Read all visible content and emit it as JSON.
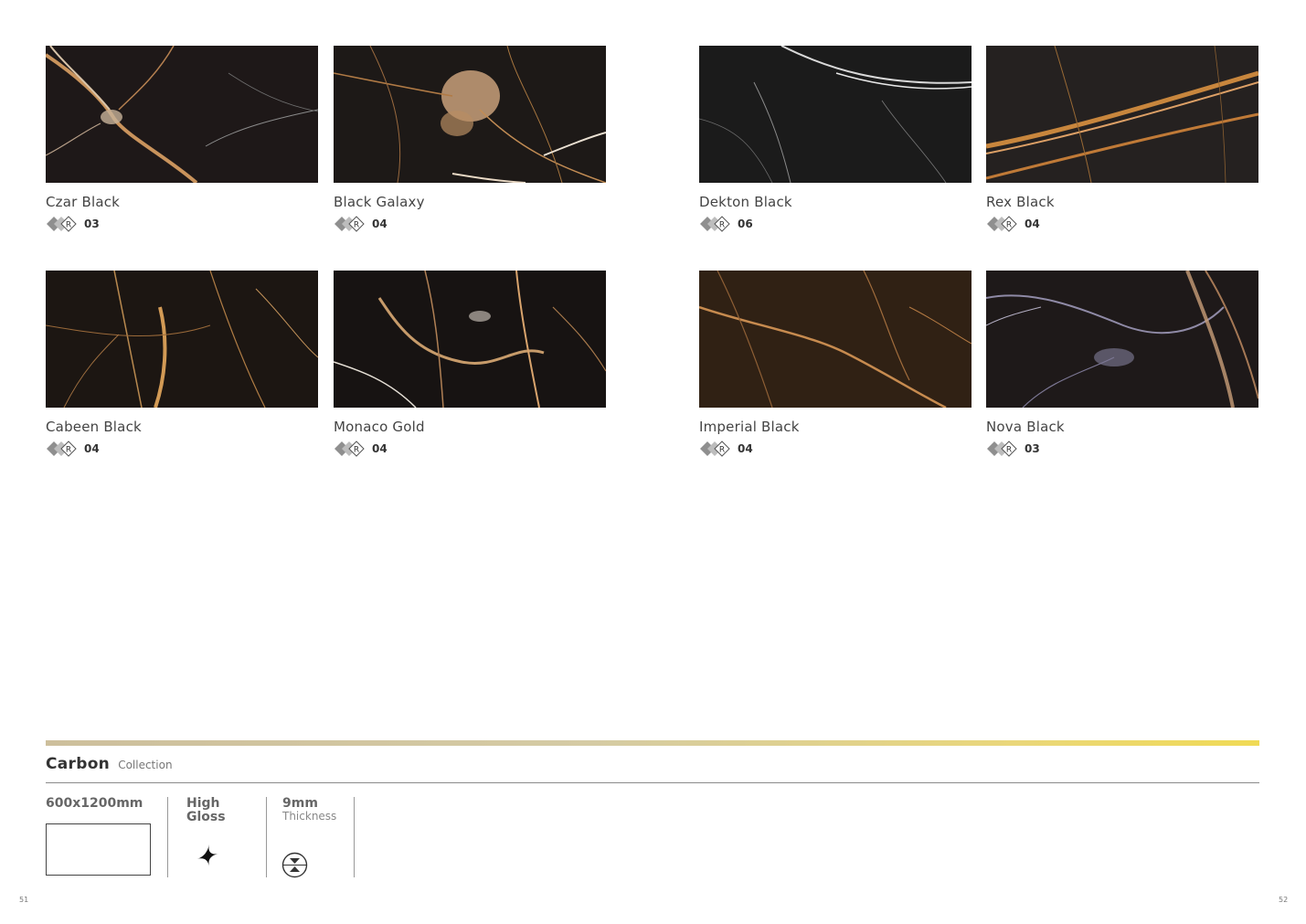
{
  "tiles": [
    {
      "name": "Czar Black",
      "rating": "03"
    },
    {
      "name": "Black Galaxy",
      "rating": "04"
    },
    {
      "name": "Dekton Black",
      "rating": "06"
    },
    {
      "name": "Rex Black",
      "rating": "04"
    },
    {
      "name": "Cabeen Black",
      "rating": "04"
    },
    {
      "name": "Monaco Gold",
      "rating": "04"
    },
    {
      "name": "Imperial Black",
      "rating": "04"
    },
    {
      "name": "Nova Black",
      "rating": "03"
    }
  ],
  "rating_badge_letter": "R",
  "collection": {
    "name": "Carbon",
    "subtitle": "Collection"
  },
  "specs": {
    "size": "600x1200mm",
    "finish_line1": "High",
    "finish_line2": "Gloss",
    "thickness_value": "9mm",
    "thickness_label": "Thickness"
  },
  "pages": {
    "left": "51",
    "right": "52"
  },
  "colors": {
    "accent_gold": "#d9c77c",
    "marble_base": "#1c1714"
  }
}
